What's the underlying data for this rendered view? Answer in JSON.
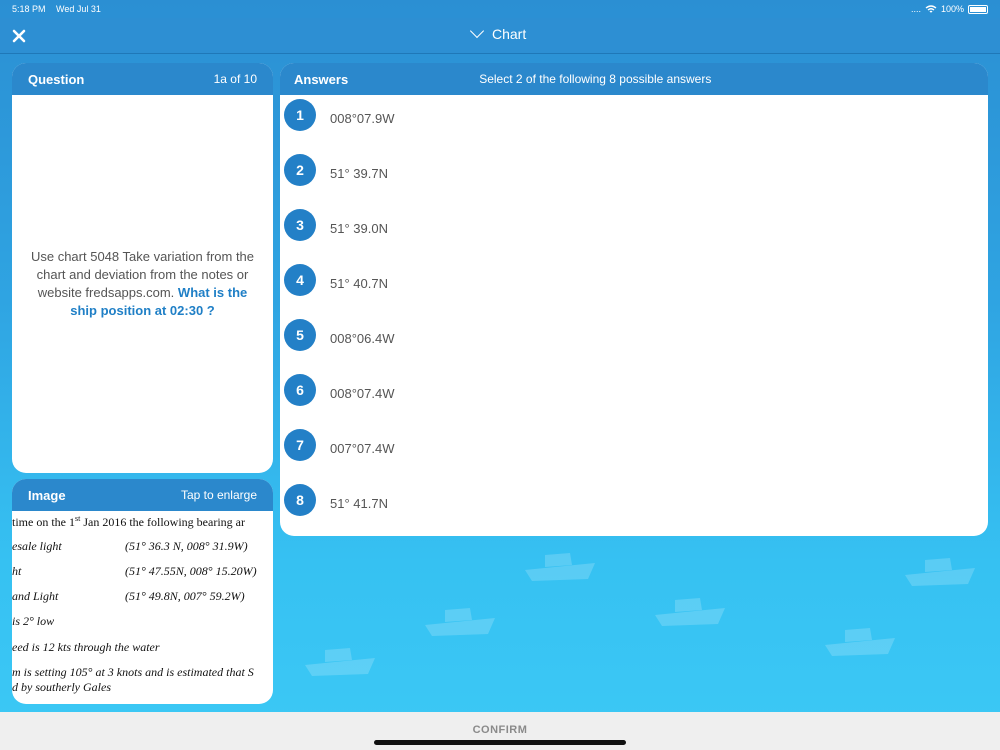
{
  "status_bar": {
    "time": "5:18 PM",
    "date": "Wed Jul 31",
    "signal_dots": "....",
    "battery": "100%"
  },
  "nav": {
    "title": "Chart",
    "close_icon": "close-icon",
    "chevron_icon": "chevron-down-icon"
  },
  "question": {
    "title": "Question",
    "counter": "1a of 10",
    "text_plain": "Use chart 5048 Take variation from the chart and deviation from the notes or website fredsapps.com. ",
    "text_highlight": "What is the ship position at 02:30 ?"
  },
  "image": {
    "title": "Image",
    "action": "Tap to enlarge",
    "lines": {
      "l1_pre": "time on the 1",
      "l1_sup": "st",
      "l1_post": " Jan 2016 the following bearing ar",
      "l2_name": "esale light",
      "l2_coord": "(51° 36.3 N, 008° 31.9W)",
      "l3_name": "ht",
      "l3_coord": "(51° 47.55N, 008° 15.20W)",
      "l4_name": "and Light",
      "l4_coord": "(51° 49.8N, 007° 59.2W)",
      "l5": "is 2° low",
      "l6": "eed is 12 kts through the water",
      "l7": "m is setting 105° at 3 knots and is estimated that S",
      "l8": "d by southerly Gales"
    }
  },
  "answers": {
    "title": "Answers",
    "instruction": "Select 2 of the following 8 possible answers",
    "items": [
      {
        "num": "1",
        "text": "008°07.9W"
      },
      {
        "num": "2",
        "text": "51° 39.7N"
      },
      {
        "num": "3",
        "text": "51° 39.0N"
      },
      {
        "num": "4",
        "text": "51° 40.7N"
      },
      {
        "num": "5",
        "text": "008°06.4W"
      },
      {
        "num": "6",
        "text": "008°07.4W"
      },
      {
        "num": "7",
        "text": "007°07.4W"
      },
      {
        "num": "8",
        "text": "51° 41.7N"
      }
    ]
  },
  "footer": {
    "confirm_label": "CONFIRM"
  }
}
